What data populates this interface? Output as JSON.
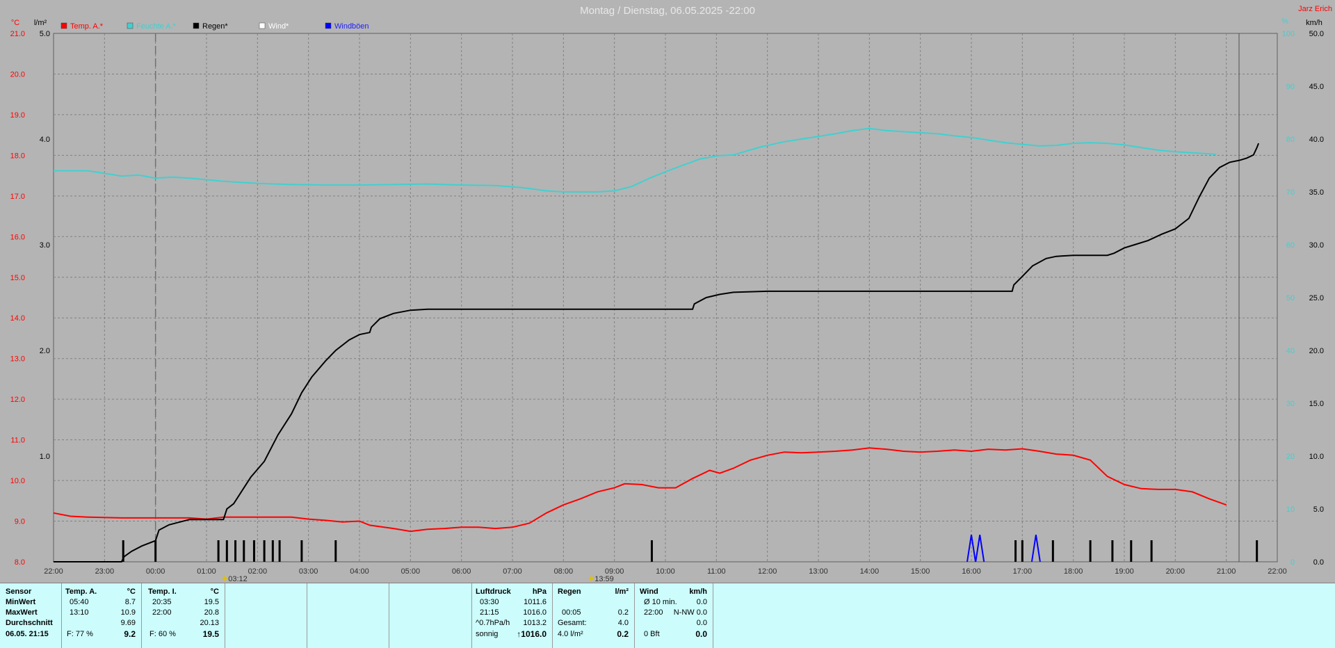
{
  "title": "Montag / Dienstag, 06.05.2025  -22:00",
  "station": "Jarz Erich",
  "colors": {
    "temp": "#ff0000",
    "hum": "#40d0d0",
    "rain": "#000000",
    "wind": "#ffffff",
    "gust": "#0000ff",
    "plot_bg": "#b4b4b4",
    "grid": "#808080"
  },
  "chart_data": {
    "type": "line",
    "axes": {
      "temp": {
        "unit": "°C",
        "min": 8,
        "max": 21,
        "ticks": [
          "8.0",
          "9.0",
          "10.0",
          "11.0",
          "12.0",
          "13.0",
          "14.0",
          "15.0",
          "16.0",
          "17.0",
          "18.0",
          "19.0",
          "20.0",
          "21.0"
        ]
      },
      "rain": {
        "unit": "l/m²",
        "min": 0,
        "max": 5,
        "ticks": [
          "1.0",
          "2.0",
          "3.0",
          "4.0",
          "5.0"
        ]
      },
      "hum": {
        "unit": "%",
        "min": 0,
        "max": 100,
        "ticks": [
          "0",
          "10",
          "20",
          "30",
          "40",
          "50",
          "60",
          "70",
          "80",
          "90",
          "100"
        ]
      },
      "wind": {
        "unit": "km/h",
        "min": 0,
        "max": 50,
        "ticks": [
          "0.0",
          "5.0",
          "10.0",
          "15.0",
          "20.0",
          "25.0",
          "30.0",
          "35.0",
          "40.0",
          "45.0",
          "50.0"
        ]
      }
    },
    "x_ticks": [
      "22:00",
      "23:00",
      "00:00",
      "01:00",
      "02:00",
      "03:00",
      "04:00",
      "05:00",
      "06:00",
      "07:00",
      "08:00",
      "09:00",
      "10:00",
      "11:00",
      "12:00",
      "13:00",
      "14:00",
      "15:00",
      "16:00",
      "17:00",
      "18:00",
      "19:00",
      "20:00",
      "21:00",
      "22:00"
    ],
    "markers": [
      {
        "label": "03:12",
        "hour": 5.2
      },
      {
        "label": "13:59",
        "hour": 15.98
      }
    ],
    "legend": [
      "Temp. A.*",
      "Feuchte A.*",
      "Regen*",
      "Wind*",
      "Windböen"
    ],
    "series": [
      {
        "name": "Temp. A.*",
        "axis": "temp",
        "color": "#ff0000",
        "points": [
          [
            0,
            9.2
          ],
          [
            0.5,
            9.12
          ],
          [
            1,
            9.1
          ],
          [
            2,
            9.08
          ],
          [
            3,
            9.08
          ],
          [
            3.5,
            9.08
          ],
          [
            4,
            9.08
          ],
          [
            4.5,
            9.05
          ],
          [
            5,
            9.1
          ],
          [
            6,
            9.1
          ],
          [
            7,
            9.1
          ],
          [
            7.5,
            9.05
          ],
          [
            8,
            9.02
          ],
          [
            8.5,
            8.98
          ],
          [
            9,
            9.0
          ],
          [
            9.3,
            8.9
          ],
          [
            10,
            8.82
          ],
          [
            10.5,
            8.75
          ],
          [
            11,
            8.8
          ],
          [
            11.5,
            8.82
          ],
          [
            12,
            8.85
          ],
          [
            12.5,
            8.85
          ],
          [
            13,
            8.82
          ],
          [
            13.5,
            8.85
          ],
          [
            14,
            8.95
          ],
          [
            14.5,
            9.2
          ],
          [
            15,
            9.4
          ],
          [
            15.5,
            9.55
          ],
          [
            16,
            9.72
          ],
          [
            16.5,
            9.82
          ],
          [
            16.8,
            9.92
          ],
          [
            17.3,
            9.9
          ],
          [
            17.8,
            9.82
          ],
          [
            18.3,
            9.82
          ],
          [
            18.8,
            10.05
          ],
          [
            19.3,
            10.25
          ],
          [
            19.6,
            10.18
          ],
          [
            20,
            10.3
          ],
          [
            20.5,
            10.5
          ],
          [
            21,
            10.62
          ],
          [
            21.5,
            10.7
          ],
          [
            22,
            10.68
          ],
          [
            22.5,
            10.7
          ],
          [
            23,
            10.72
          ],
          [
            23.5,
            10.75
          ],
          [
            24,
            10.8
          ],
          [
            24.5,
            10.77
          ],
          [
            25,
            10.72
          ],
          [
            25.5,
            10.7
          ],
          [
            26,
            10.72
          ],
          [
            26.5,
            10.75
          ],
          [
            27,
            10.72
          ],
          [
            27.5,
            10.77
          ],
          [
            28,
            10.75
          ],
          [
            28.5,
            10.78
          ],
          [
            29,
            10.72
          ],
          [
            29.5,
            10.65
          ],
          [
            30,
            10.62
          ],
          [
            30.5,
            10.5
          ],
          [
            31,
            10.1
          ],
          [
            31.5,
            9.9
          ],
          [
            32,
            9.8
          ],
          [
            32.5,
            9.78
          ],
          [
            33,
            9.78
          ],
          [
            33.5,
            9.72
          ],
          [
            34,
            9.55
          ],
          [
            34.5,
            9.4
          ]
        ]
      },
      {
        "name": "Feuchte A.*",
        "axis": "hum",
        "color": "#40d0d0",
        "points": [
          [
            0,
            74
          ],
          [
            1,
            74
          ],
          [
            1.5,
            73.5
          ],
          [
            2,
            73
          ],
          [
            2.5,
            73.2
          ],
          [
            3,
            72.6
          ],
          [
            3.5,
            72.8
          ],
          [
            4,
            72.6
          ],
          [
            5,
            72
          ],
          [
            6,
            71.6
          ],
          [
            7,
            71.4
          ],
          [
            8,
            71.3
          ],
          [
            9,
            71.3
          ],
          [
            10,
            71.4
          ],
          [
            11,
            71.5
          ],
          [
            12,
            71.3
          ],
          [
            13,
            71.2
          ],
          [
            13.8,
            70.8
          ],
          [
            14.5,
            70.2
          ],
          [
            15,
            70
          ],
          [
            16,
            70
          ],
          [
            16.5,
            70.2
          ],
          [
            17,
            71
          ],
          [
            17.5,
            72.5
          ],
          [
            18,
            73.8
          ],
          [
            18.5,
            75
          ],
          [
            19,
            76.2
          ],
          [
            19.5,
            76.8
          ],
          [
            20,
            77
          ],
          [
            20.8,
            78.5
          ],
          [
            21.5,
            79.5
          ],
          [
            22,
            80
          ],
          [
            22.5,
            80.5
          ],
          [
            23,
            81
          ],
          [
            23.5,
            81.6
          ],
          [
            24,
            82
          ],
          [
            24.5,
            81.6
          ],
          [
            25,
            81.4
          ],
          [
            25.5,
            81.2
          ],
          [
            26,
            81
          ],
          [
            26.5,
            80.6
          ],
          [
            27,
            80.3
          ],
          [
            27.5,
            79.8
          ],
          [
            28,
            79.3
          ],
          [
            28.5,
            79
          ],
          [
            29,
            78.7
          ],
          [
            29.5,
            78.8
          ],
          [
            30,
            79.2
          ],
          [
            30.5,
            79.3
          ],
          [
            31,
            79.2
          ],
          [
            31.5,
            78.9
          ],
          [
            32,
            78.4
          ],
          [
            32.5,
            77.9
          ],
          [
            33,
            77.6
          ],
          [
            33.5,
            77.4
          ],
          [
            34,
            77.2
          ],
          [
            34.2,
            77.1
          ]
        ]
      },
      {
        "name": "Regen*",
        "axis": "rain",
        "color": "#000000",
        "points": [
          [
            0,
            0
          ],
          [
            1,
            0
          ],
          [
            2,
            0
          ],
          [
            2.08,
            0.05
          ],
          [
            2.3,
            0.1
          ],
          [
            2.6,
            0.15
          ],
          [
            3,
            0.2
          ],
          [
            3.1,
            0.3
          ],
          [
            3.4,
            0.35
          ],
          [
            4,
            0.4
          ],
          [
            4.5,
            0.4
          ],
          [
            5,
            0.4
          ],
          [
            5.1,
            0.5
          ],
          [
            5.3,
            0.55
          ],
          [
            5.5,
            0.65
          ],
          [
            5.8,
            0.8
          ],
          [
            6.2,
            0.95
          ],
          [
            6.6,
            1.2
          ],
          [
            7,
            1.4
          ],
          [
            7.3,
            1.6
          ],
          [
            7.6,
            1.75
          ],
          [
            8,
            1.9
          ],
          [
            8.3,
            2.0
          ],
          [
            8.7,
            2.1
          ],
          [
            9.0,
            2.15
          ],
          [
            9.3,
            2.17
          ],
          [
            9.35,
            2.22
          ],
          [
            9.6,
            2.3
          ],
          [
            10,
            2.35
          ],
          [
            10.5,
            2.38
          ],
          [
            11,
            2.39
          ],
          [
            13,
            2.39
          ],
          [
            15,
            2.39
          ],
          [
            17,
            2.39
          ],
          [
            18.8,
            2.39
          ],
          [
            18.85,
            2.44
          ],
          [
            19.2,
            2.5
          ],
          [
            19.6,
            2.53
          ],
          [
            20,
            2.55
          ],
          [
            21,
            2.56
          ],
          [
            23,
            2.56
          ],
          [
            25,
            2.56
          ],
          [
            27,
            2.56
          ],
          [
            28.2,
            2.56
          ],
          [
            28.25,
            2.62
          ],
          [
            28.5,
            2.7
          ],
          [
            28.8,
            2.8
          ],
          [
            29.2,
            2.87
          ],
          [
            29.5,
            2.89
          ],
          [
            30,
            2.9
          ],
          [
            30.5,
            2.9
          ],
          [
            31,
            2.9
          ],
          [
            31.2,
            2.92
          ],
          [
            31.5,
            2.97
          ],
          [
            31.8,
            3.0
          ],
          [
            32.2,
            3.04
          ],
          [
            32.6,
            3.1
          ],
          [
            33,
            3.15
          ],
          [
            33.4,
            3.25
          ],
          [
            33.7,
            3.45
          ],
          [
            34,
            3.63
          ],
          [
            34.3,
            3.73
          ],
          [
            34.6,
            3.78
          ],
          [
            34.9,
            3.8
          ],
          [
            35.1,
            3.82
          ],
          [
            35.3,
            3.85
          ],
          [
            35.4,
            3.92
          ],
          [
            35.45,
            3.96
          ]
        ]
      },
      {
        "name": "Windböen",
        "axis": "wind",
        "color": "#0000ff",
        "peaks": [
          {
            "hour": 27.0,
            "value": 1.5
          },
          {
            "hour": 27.25,
            "value": 1.5
          },
          {
            "hour": 28.9,
            "value": 1.5
          }
        ]
      }
    ],
    "rain_ticks": [
      2.05,
      3.0,
      4.85,
      5.1,
      5.35,
      5.6,
      5.9,
      6.2,
      6.45,
      6.65,
      7.3,
      8.3,
      17.6,
      28.3,
      28.5,
      29.4,
      30.5,
      31.15,
      31.7,
      32.3,
      35.4
    ]
  },
  "info": {
    "sensor": {
      "label": "Sensor",
      "min": "MinWert",
      "max": "MaxWert",
      "avg": "Durchschnitt",
      "now": "06.05. 21:15"
    },
    "temp_a": {
      "label": "Temp. A.",
      "unit": "°C",
      "min_time": "05:40",
      "min": "8.7",
      "max_time": "13:10",
      "max": "10.9",
      "avg": "9.69",
      "hum": "F: 77 %",
      "now": "9.2"
    },
    "temp_i": {
      "label": "Temp. I.",
      "unit": "°C",
      "min_time": "20:35",
      "min": "19.5",
      "max_time": "22:00",
      "max": "20.8",
      "avg": "20.13",
      "hum": "F: 60 %",
      "now": "19.5"
    },
    "luftdruck": {
      "label": "Luftdruck",
      "unit": "hPa",
      "min_time": "03:30",
      "min": "1011.6",
      "max_time": "21:15",
      "max": "1016.0",
      "trend": "^0.7hPa/h",
      "avg": "1013.2",
      "weather": "sonnig",
      "now": "↑1016.0"
    },
    "regen": {
      "label": "Regen",
      "unit": "l/m²",
      "time": "00:05",
      "val": "0.2",
      "total_label": "Gesamt:",
      "total": "4.0",
      "today": "4.0 l/m²",
      "now": "0.2"
    },
    "wind": {
      "label": "Wind",
      "unit": "km/h",
      "avg10": "Ø 10 min.",
      "avg10_val": "0.0",
      "time": "22:00",
      "dir": "N-NW 0.0",
      "v3": "0.0",
      "bft": "0 Bft",
      "now": "0.0"
    }
  }
}
